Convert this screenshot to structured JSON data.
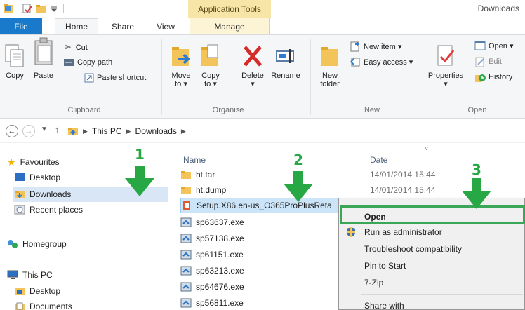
{
  "window": {
    "context_header": "Application Tools",
    "title": "Downloads"
  },
  "tabs": {
    "file": "File",
    "home": "Home",
    "share": "Share",
    "view": "View",
    "manage": "Manage"
  },
  "ribbon": {
    "clipboard": {
      "copy": "Copy",
      "paste": "Paste",
      "cut": "Cut",
      "copy_path": "Copy path",
      "paste_shortcut": "Paste shortcut",
      "label": "Clipboard"
    },
    "organise": {
      "move_to": "Move",
      "move_to_2": "to ▾",
      "copy_to": "Copy",
      "copy_to_2": "to ▾",
      "delete": "Delete",
      "delete_caret": "▾",
      "rename": "Rename",
      "label": "Organise"
    },
    "new": {
      "new_folder": "New",
      "new_folder_2": "folder",
      "new_item": "New item ▾",
      "easy_access": "Easy access ▾",
      "label": "New"
    },
    "open": {
      "properties": "Properties",
      "properties_caret": "▾",
      "open": "Open ▾",
      "edit": "Edit",
      "history": "History",
      "label": "Open"
    }
  },
  "address": {
    "crumbs": [
      "This PC",
      "Downloads"
    ]
  },
  "nav": {
    "favourites": "Favourites",
    "desktop": "Desktop",
    "downloads": "Downloads",
    "recent": "Recent places",
    "homegroup": "Homegroup",
    "this_pc": "This PC",
    "pc_desktop": "Desktop",
    "documents": "Documents"
  },
  "list": {
    "col_name": "Name",
    "col_date": "Date",
    "files": [
      {
        "name": "ht.tar",
        "date": "14/01/2014 15:44",
        "icon": "folder-icon"
      },
      {
        "name": "ht.dump",
        "date": "14/01/2014 15:44",
        "icon": "folder-icon"
      },
      {
        "name": "Setup.X86.en-us_O365ProPlusReta",
        "date": "",
        "icon": "office-icon"
      },
      {
        "name": "sp63637.exe",
        "date": "",
        "icon": "installer-icon"
      },
      {
        "name": "sp57138.exe",
        "date": "",
        "icon": "installer-icon"
      },
      {
        "name": "sp61151.exe",
        "date": "",
        "icon": "installer-icon"
      },
      {
        "name": "sp63213.exe",
        "date": "",
        "icon": "installer-icon"
      },
      {
        "name": "sp64676.exe",
        "date": "",
        "icon": "installer-icon"
      },
      {
        "name": "sp56811.exe",
        "date": "",
        "icon": "installer-icon"
      }
    ]
  },
  "context_menu": {
    "open": "Open",
    "run_as_admin": "Run as administrator",
    "troubleshoot": "Troubleshoot compatibility",
    "pin_to_start": "Pin to Start",
    "seven_zip": "7-Zip",
    "share_with": "Share with"
  },
  "annotations": {
    "step1": "1",
    "step2": "2",
    "step3": "3",
    "color": "#27a844"
  }
}
